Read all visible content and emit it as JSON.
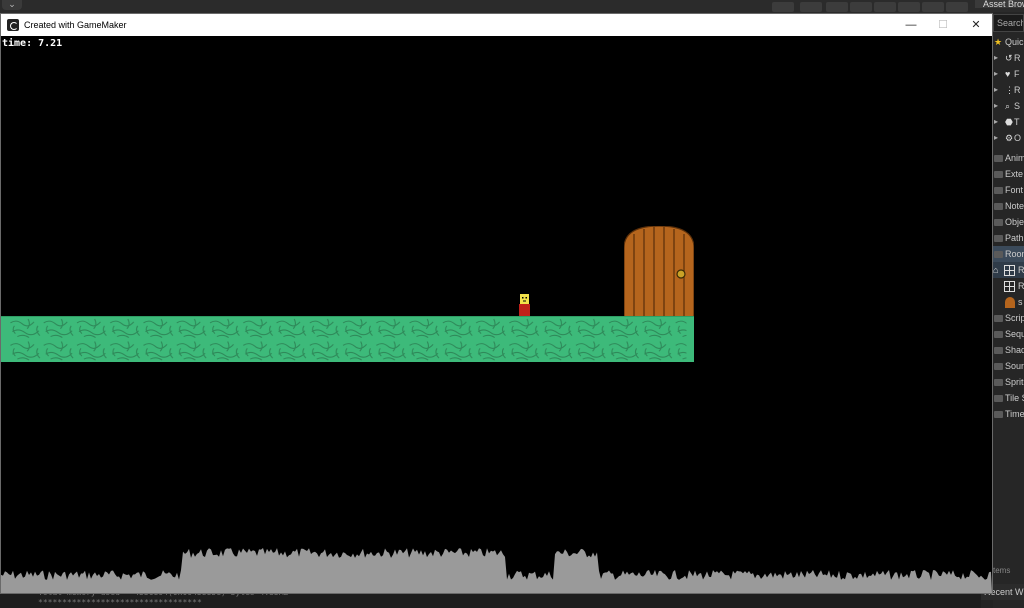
{
  "window": {
    "title": "Created with GameMaker",
    "minimize_icon": "—",
    "maximize_icon": "☐",
    "close_icon": "✕"
  },
  "hud": {
    "timer_text": "time: 7.21"
  },
  "ide": {
    "asset_browser_tab": "Asset Brow",
    "search_placeholder": "Search",
    "quick_access": [
      {
        "label": "Quick",
        "icon": "star-icon"
      },
      {
        "label": "R",
        "icon": "recent-icon"
      },
      {
        "label": "F",
        "icon": "heart-icon"
      },
      {
        "label": "R",
        "icon": "resource-icon"
      },
      {
        "label": "S",
        "icon": "search-icon"
      },
      {
        "label": "T",
        "icon": "tag-icon"
      },
      {
        "label": "O",
        "icon": "gear-icon"
      }
    ],
    "folders": [
      "Anim",
      "Exte",
      "Font",
      "Note",
      "Obje",
      "Path",
      "Room"
    ],
    "room_items": [
      "R",
      "R",
      "s"
    ],
    "folders_after": [
      "Scrip",
      "Sequ",
      "Shad",
      "Soun",
      "Sprit",
      "Tile S",
      "Time"
    ],
    "items_label": "tems",
    "recent_window_label": "Recent Wi",
    "output_lines": [
      "Total memory used = 4556894(0x0045885e) bytes 4.35MB",
      "**********************************"
    ]
  },
  "colors": {
    "platform": "#3dba7a",
    "platform_pattern": "#2f8a5a",
    "door": "#b5651d",
    "door_lines": "#5a2f0a",
    "door_knob": "#c9a227",
    "player_body": "#c0201a",
    "player_head": "#f2e14a",
    "perf_bars": "#9a9a9a"
  }
}
